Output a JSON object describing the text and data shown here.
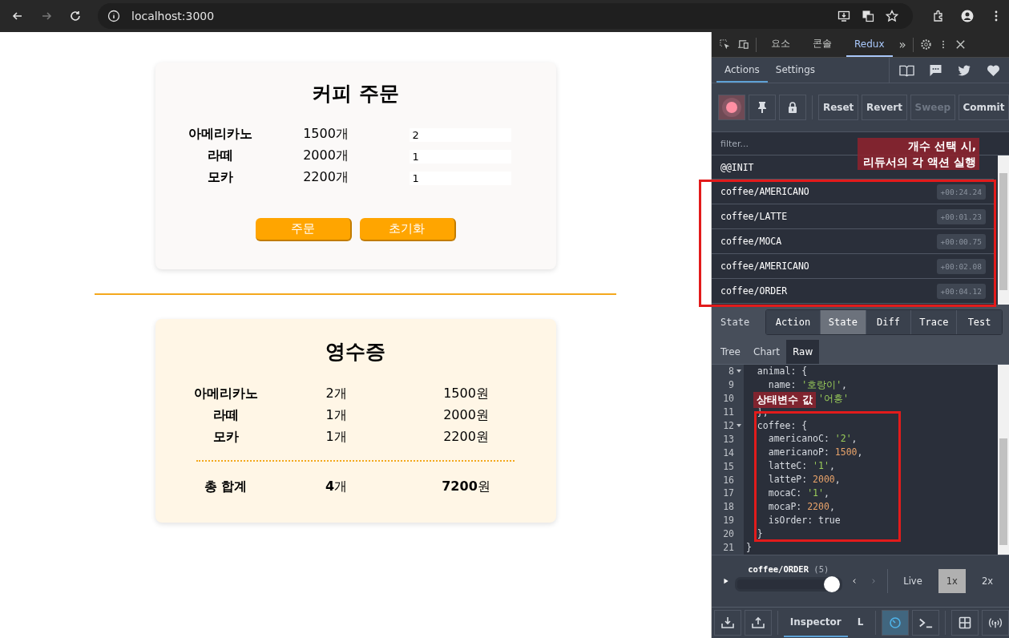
{
  "browser": {
    "url": "localhost:3000"
  },
  "order_card": {
    "title": "커피 주문",
    "items": [
      {
        "name": "아메리카노",
        "price": "1500개",
        "quantity": "2"
      },
      {
        "name": "라떼",
        "price": "2000개",
        "quantity": "1"
      },
      {
        "name": "모카",
        "price": "2200개",
        "quantity": "1"
      }
    ],
    "buttons": [
      "주문",
      "초기화"
    ]
  },
  "receipt_card": {
    "title": "영수증",
    "items": [
      {
        "name": "아메리카노",
        "count": "2개",
        "amount": "1500원"
      },
      {
        "name": "라떼",
        "count": "1개",
        "amount": "2000원"
      },
      {
        "name": "모카",
        "count": "1개",
        "amount": "2200원"
      }
    ],
    "total": {
      "label": "총 합계",
      "count": "**4**개",
      "amount": "**7200**원"
    }
  },
  "devtools": {
    "tabs": [
      {
        "label": "요소",
        "selected": false
      },
      {
        "label": "콘솔",
        "selected": false
      },
      {
        "label": "Redux",
        "selected": true
      }
    ],
    "more": "»",
    "redux": {
      "tabs": [
        {
          "label": "Actions",
          "selected": true
        },
        {
          "label": "Settings",
          "selected": false
        }
      ],
      "record_on": true,
      "buttons": [
        {
          "label": "Reset",
          "disabled": false
        },
        {
          "label": "Revert",
          "disabled": false
        },
        {
          "label": "Sweep",
          "disabled": true
        },
        {
          "label": "Commit",
          "disabled": false
        }
      ],
      "filter": {
        "placeholder": "filter..."
      },
      "actions": [
        {
          "type": "@@INIT"
        },
        {
          "type": "coffee/AMERICANO",
          "time": "+00:24.24"
        },
        {
          "type": "coffee/LATTE",
          "time": "+00:01.23"
        },
        {
          "type": "coffee/MOCA",
          "time": "+00:00.75"
        },
        {
          "type": "coffee/AMERICANO",
          "time": "+00:02.08"
        },
        {
          "type": "coffee/ORDER",
          "time": "+00:04.12"
        }
      ],
      "state_label": "State",
      "inspector_tabs": [
        {
          "label": "Action",
          "selected": false
        },
        {
          "label": "State",
          "selected": true
        },
        {
          "label": "Diff",
          "selected": false
        },
        {
          "label": "Trace",
          "selected": false
        },
        {
          "label": "Test",
          "selected": false
        }
      ],
      "view_tabs": [
        {
          "label": "Tree",
          "selected": false
        },
        {
          "label": "Chart",
          "selected": false
        },
        {
          "label": "Raw",
          "selected": true
        }
      ],
      "code_lines": [
        {
          "no": "8",
          "fold": true,
          "parts": [
            {
              "t": "  animal: {",
              "kind": "plain"
            }
          ]
        },
        {
          "no": "9",
          "fold": false,
          "parts": [
            {
              "t": "    name: ",
              "kind": "plain"
            },
            {
              "t": "'호랑이'",
              "kind": "string"
            },
            {
              "t": ",",
              "kind": "plain"
            }
          ]
        },
        {
          "no": "10",
          "fold": false,
          "parts": [
            {
              "t": "             '어흥'",
              "kind": "string"
            }
          ]
        },
        {
          "no": "11",
          "fold": false,
          "parts": [
            {
              "t": "  },",
              "kind": "plain"
            }
          ]
        },
        {
          "no": "12",
          "fold": true,
          "parts": [
            {
              "t": "  coffee: {",
              "kind": "plain"
            }
          ]
        },
        {
          "no": "13",
          "fold": false,
          "parts": [
            {
              "t": "    americanoC: ",
              "kind": "plain"
            },
            {
              "t": "'2'",
              "kind": "string"
            },
            {
              "t": ",",
              "kind": "plain"
            }
          ]
        },
        {
          "no": "14",
          "fold": false,
          "parts": [
            {
              "t": "    americanoP: ",
              "kind": "plain"
            },
            {
              "t": "1500",
              "kind": "number"
            },
            {
              "t": ",",
              "kind": "plain"
            }
          ]
        },
        {
          "no": "15",
          "fold": false,
          "parts": [
            {
              "t": "    latteC: ",
              "kind": "plain"
            },
            {
              "t": "'1'",
              "kind": "string"
            },
            {
              "t": ",",
              "kind": "plain"
            }
          ]
        },
        {
          "no": "16",
          "fold": false,
          "parts": [
            {
              "t": "    latteP: ",
              "kind": "plain"
            },
            {
              "t": "2000",
              "kind": "number"
            },
            {
              "t": ",",
              "kind": "plain"
            }
          ]
        },
        {
          "no": "17",
          "fold": false,
          "parts": [
            {
              "t": "    mocaC: ",
              "kind": "plain"
            },
            {
              "t": "'1'",
              "kind": "string"
            },
            {
              "t": ",",
              "kind": "plain"
            }
          ]
        },
        {
          "no": "18",
          "fold": false,
          "parts": [
            {
              "t": "    mocaP: ",
              "kind": "plain"
            },
            {
              "t": "2200",
              "kind": "number"
            },
            {
              "t": ",",
              "kind": "plain"
            }
          ]
        },
        {
          "no": "19",
          "fold": false,
          "parts": [
            {
              "t": "    isOrder: ",
              "kind": "plain"
            },
            {
              "t": "true",
              "kind": "plain"
            }
          ]
        },
        {
          "no": "20",
          "fold": false,
          "parts": [
            {
              "t": "  }",
              "kind": "plain"
            }
          ]
        },
        {
          "no": "21",
          "fold": false,
          "parts": [
            {
              "t": "}",
              "kind": "plain"
            }
          ]
        }
      ],
      "slider": {
        "label": "coffee/ORDER",
        "count": "(5)",
        "level": 1
      },
      "speeds": [
        {
          "label": "Live",
          "selected": false
        },
        {
          "label": "1x",
          "selected": true
        },
        {
          "label": "2x",
          "selected": false
        }
      ],
      "bottom_tabs": [
        {
          "label": "Inspector",
          "selected": true
        },
        {
          "label": "L",
          "selected": false
        }
      ]
    }
  },
  "annotations": [
    {
      "lines": [
        "개수 선택 시,",
        "리듀서의 각 액션 실행"
      ]
    },
    {
      "lines": [
        "상태변수 값"
      ]
    }
  ]
}
